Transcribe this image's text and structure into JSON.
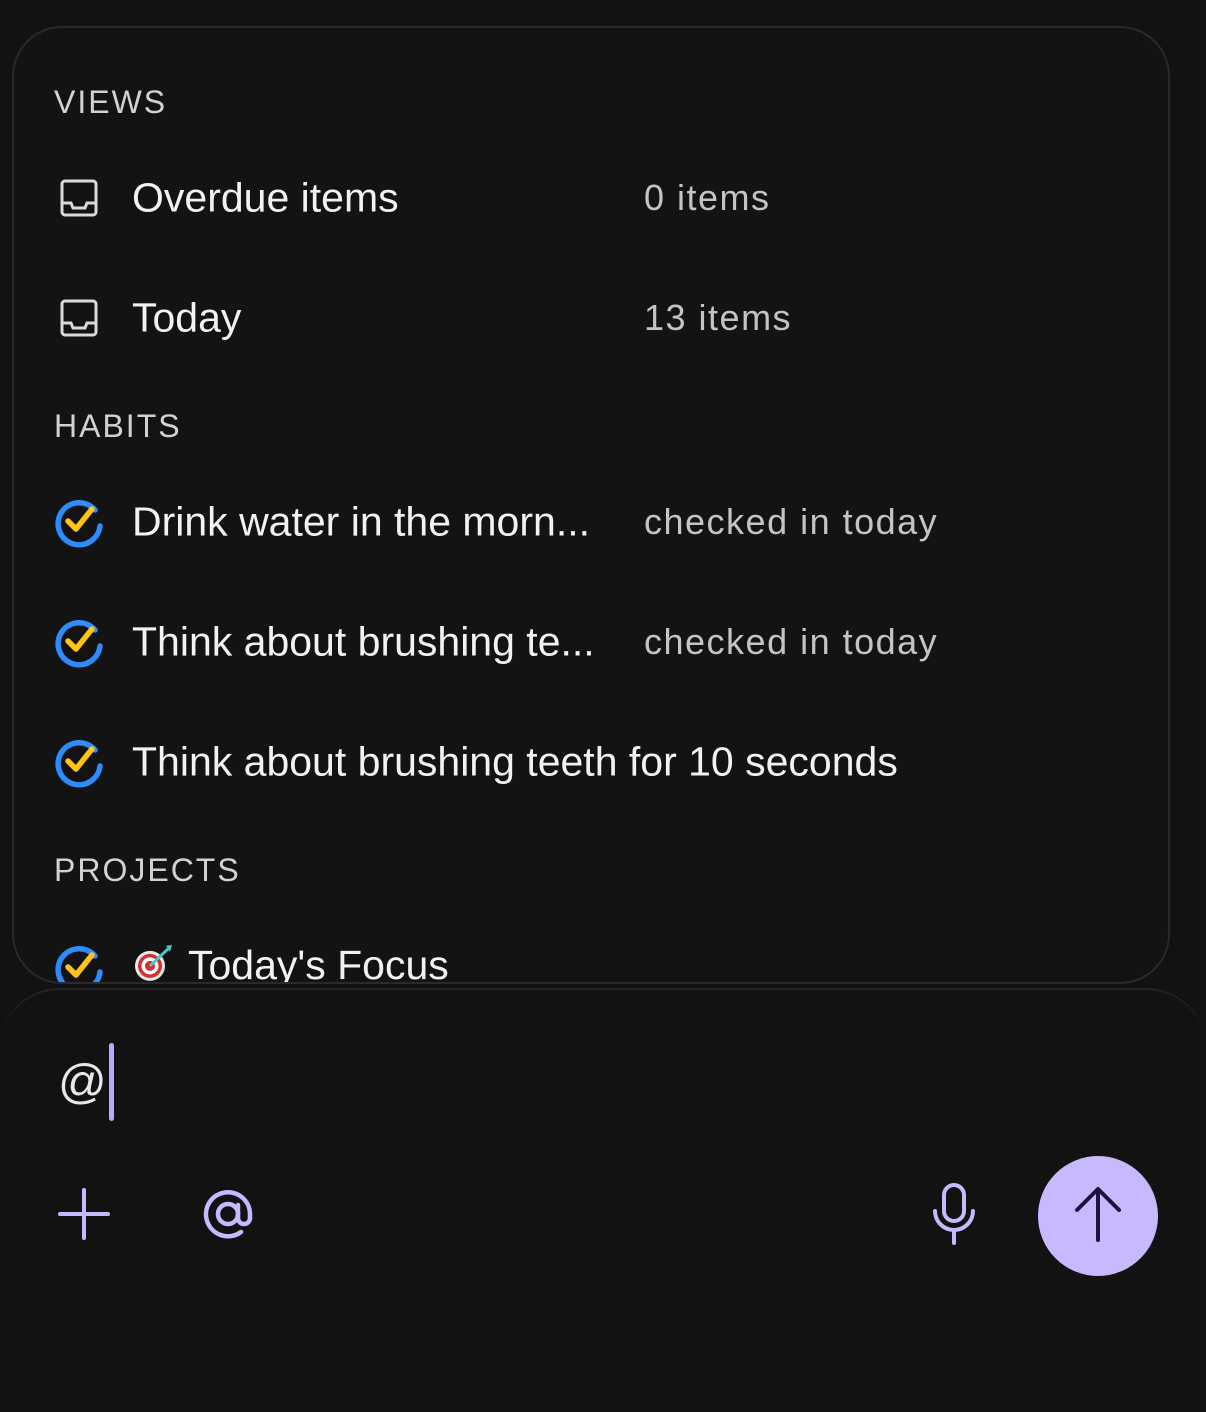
{
  "views": {
    "header": "VIEWS",
    "items": [
      {
        "icon": "inbox-icon",
        "label": "Overdue items",
        "meta": "0 items"
      },
      {
        "icon": "inbox-icon",
        "label": "Today",
        "meta": "13 items"
      }
    ]
  },
  "habits": {
    "header": "HABITS",
    "items": [
      {
        "icon": "habit-check-icon",
        "label": "Drink water in the morn...",
        "meta": "checked in today"
      },
      {
        "icon": "habit-check-icon",
        "label": "Think about brushing te...",
        "meta": "checked in today"
      },
      {
        "icon": "habit-check-icon",
        "label": "Think about brushing teeth for 10 seconds",
        "meta": ""
      }
    ]
  },
  "projects": {
    "header": "PROJECTS",
    "items": [
      {
        "icon": "habit-check-icon",
        "emoji": "🎯",
        "label": "Today's Focus"
      }
    ]
  },
  "composer": {
    "input_value": "@",
    "add_icon": "plus-icon",
    "mention_icon": "at-sign-icon",
    "mic_icon": "microphone-icon",
    "send_icon": "arrow-up-icon"
  },
  "colors": {
    "accent": "#c7b8ff",
    "check_blue": "#2f8cff",
    "check_yellow": "#ffc21a",
    "background": "#121212"
  }
}
